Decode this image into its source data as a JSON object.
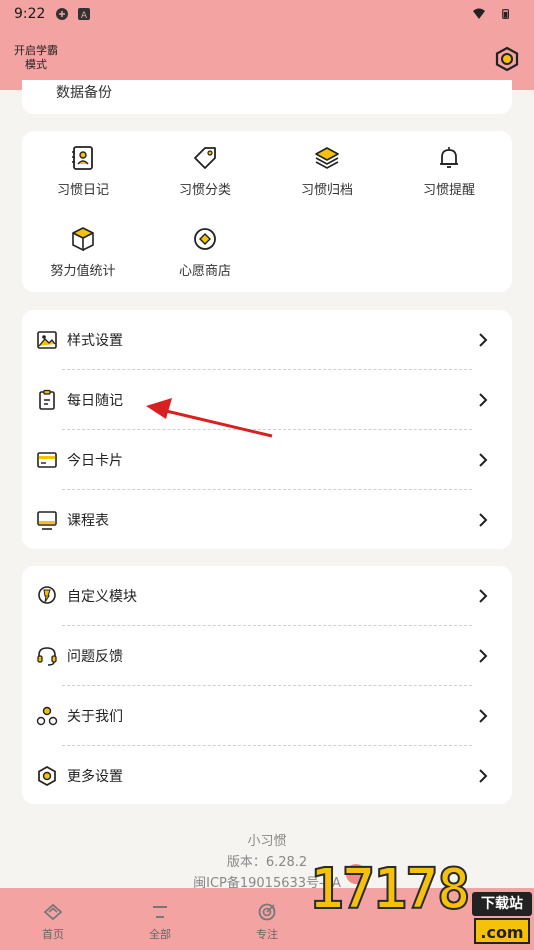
{
  "status_bar": {
    "time": "9:22"
  },
  "top_bar": {
    "mode_toggle": "开启学霸模式"
  },
  "partial_row": {
    "label": "数据备份"
  },
  "grid": [
    {
      "icon": "habit-diary-icon",
      "label": "习惯日记"
    },
    {
      "icon": "tag-icon",
      "label": "习惯分类"
    },
    {
      "icon": "layers-icon",
      "label": "习惯归档"
    },
    {
      "icon": "bell-icon",
      "label": "习惯提醒"
    },
    {
      "icon": "cube-icon",
      "label": "努力值统计"
    },
    {
      "icon": "coin-icon",
      "label": "心愿商店"
    }
  ],
  "list_a": [
    {
      "icon": "image-icon",
      "label": "样式设置"
    },
    {
      "icon": "clipboard-icon",
      "label": "每日随记"
    },
    {
      "icon": "card-icon",
      "label": "今日卡片"
    },
    {
      "icon": "monitor-icon",
      "label": "课程表"
    }
  ],
  "list_b": [
    {
      "icon": "bulb-icon",
      "label": "自定义模块"
    },
    {
      "icon": "headset-icon",
      "label": "问题反馈"
    },
    {
      "icon": "people-icon",
      "label": "关于我们"
    },
    {
      "icon": "hex-gear-icon",
      "label": "更多设置"
    }
  ],
  "footer": {
    "app_name": "小习惯",
    "version": "版本：6.28.2",
    "icp": "闽ICP备19015633号-3A"
  },
  "bottom_nav": [
    {
      "icon": "home-icon",
      "label": "首页"
    },
    {
      "icon": "list-icon",
      "label": "全部"
    },
    {
      "icon": "target-icon",
      "label": "专注"
    }
  ],
  "watermark": {
    "number": "17178",
    "badge": "下载站",
    "domain": ".com"
  },
  "colors": {
    "header_pink": "#f4a3a3",
    "accent_yellow": "#f6c10a",
    "arrow_red": "#d92020"
  }
}
